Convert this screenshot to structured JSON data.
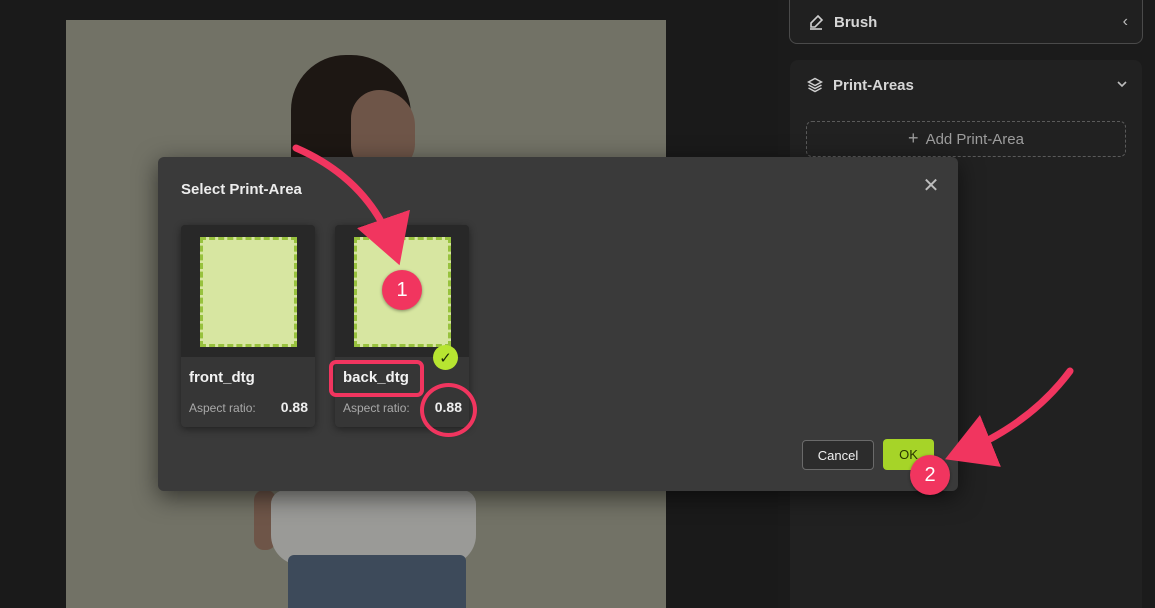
{
  "side_panel": {
    "brush": {
      "label": "Brush",
      "icon": "brush-icon"
    },
    "print_areas": {
      "label": "Print-Areas",
      "icon": "layers-icon",
      "add_label": "Add Print-Area"
    }
  },
  "dialog": {
    "title": "Select Print-Area",
    "cards": [
      {
        "name": "front_dtg",
        "ratio_label": "Aspect ratio:",
        "ratio_value": "0.88",
        "selected": false
      },
      {
        "name": "back_dtg",
        "ratio_label": "Aspect ratio:",
        "ratio_value": "0.88",
        "selected": true
      }
    ],
    "cancel_label": "Cancel",
    "ok_label": "OK"
  },
  "annotations": {
    "step1": "1",
    "step2": "2",
    "color": "#f1355f"
  },
  "colors": {
    "accent": "#a6d428",
    "print_area_fill": "#d7e6a1",
    "print_area_border": "#98c23e"
  }
}
